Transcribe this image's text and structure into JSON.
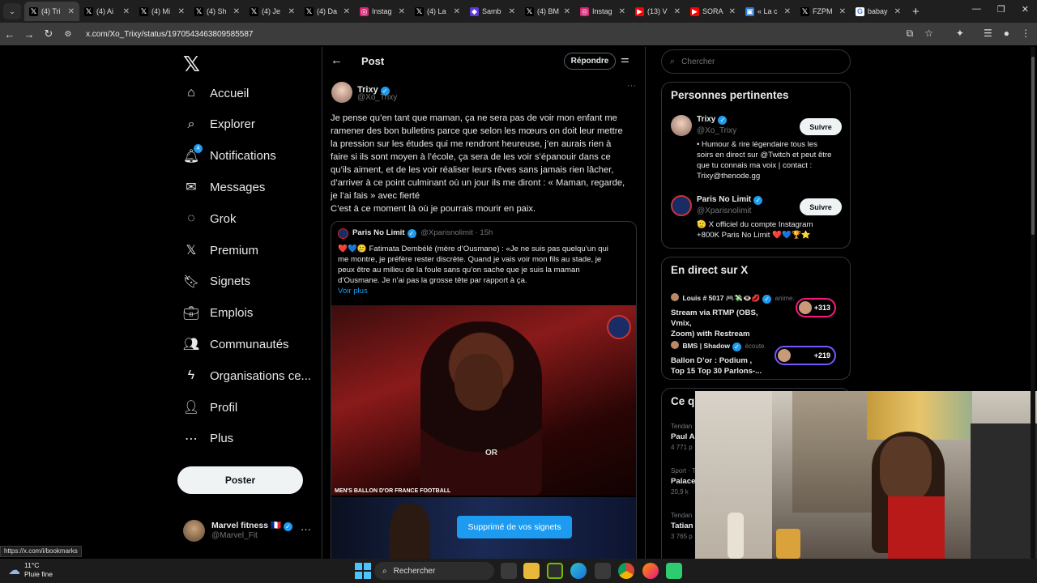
{
  "browser": {
    "tabs": [
      {
        "icon": "x-icon",
        "label": "(4) Tri",
        "active": true
      },
      {
        "icon": "x-icon",
        "label": "(4) Ai"
      },
      {
        "icon": "x-icon",
        "label": "(4) Mi"
      },
      {
        "icon": "x-icon",
        "label": "(4) Sh"
      },
      {
        "icon": "x-icon",
        "label": "(4) Je"
      },
      {
        "icon": "x-icon",
        "label": "(4) Da"
      },
      {
        "icon": "instagram-icon",
        "label": "Instag"
      },
      {
        "icon": "x-icon",
        "label": "(4) La"
      },
      {
        "icon": "samba-icon",
        "label": "Samb"
      },
      {
        "icon": "x-icon",
        "label": "(4) BM"
      },
      {
        "icon": "instagram-icon",
        "label": "Instag"
      },
      {
        "icon": "youtube-icon",
        "label": "(13) V"
      },
      {
        "icon": "youtube-icon",
        "label": "SORA"
      },
      {
        "icon": "generic-icon",
        "label": "« La c"
      },
      {
        "icon": "x-icon",
        "label": "FZPM"
      },
      {
        "icon": "google-icon",
        "label": "babay"
      }
    ],
    "url": "x.com/Xo_Trixy/status/1970543463809585587",
    "status_url": "https://x.com/i/bookmarks"
  },
  "nav": {
    "items": [
      {
        "label": "Accueil",
        "icon": "home-icon"
      },
      {
        "label": "Explorer",
        "icon": "search-icon"
      },
      {
        "label": "Notifications",
        "icon": "bell-icon",
        "badge": "4"
      },
      {
        "label": "Messages",
        "icon": "envelope-icon"
      },
      {
        "label": "Grok",
        "icon": "grok-icon"
      },
      {
        "label": "Premium",
        "icon": "x-icon"
      },
      {
        "label": "Signets",
        "icon": "bookmark-icon"
      },
      {
        "label": "Emplois",
        "icon": "briefcase-icon"
      },
      {
        "label": "Communautés",
        "icon": "people-icon"
      },
      {
        "label": "Organisations ce...",
        "icon": "lightning-icon"
      },
      {
        "label": "Profil",
        "icon": "person-icon"
      },
      {
        "label": "Plus",
        "icon": "more-circle-icon"
      }
    ],
    "post_button": "Poster",
    "account": {
      "name": "Marvel fitness 🇫🇷",
      "handle": "@Marvel_Fit"
    }
  },
  "main": {
    "header_title": "Post",
    "reply_button": "Répondre",
    "tweet": {
      "author": "Trixy",
      "handle": "@Xo_Trixy",
      "text_lines": [
        "Je pense qu’en tant que maman, ça ne sera pas de voir mon enfant me",
        "ramener des bon bulletins parce que selon les mœurs on doit leur mettre",
        "la pression sur les études qui me rendront heureuse, j’en aurais rien à",
        "faire si ils sont moyen à l’école, ça sera de les voir s’épanouir dans ce",
        "qu’ils aiment, et de les voir réaliser leurs rêves sans jamais rien lâcher,",
        "d’arriver à ce point culminant où un jour ils me diront : « Maman, regarde,",
        "je l’ai fais » avec fierté",
        "C’est à ce moment là où je pourrais mourir en paix."
      ]
    },
    "quote": {
      "author": "Paris No Limit",
      "handle": "@Xparisnolimit",
      "time": "· 15h",
      "text_lines": [
        "❤️💙🥲 Fatimata Dembélé (mère d’Ousmane) : «Je ne suis pas quelqu’un qui",
        "me montre, je préfère rester discrète. Quand je vais voir mon fils au stade, je",
        "peux être au milieu de la foule sans qu’on sache que je suis la maman",
        "d’Ousmane. Je n’ai pas la grosse tête par rapport à ça."
      ],
      "see_more": "Voir plus",
      "image_caption": "MEN'S BALLON D'OR FRANCE FOOTBALL",
      "image_text": "OR"
    },
    "toast": "Supprimé de vos signets"
  },
  "right": {
    "search_placeholder": "Chercher",
    "relevant": {
      "title": "Personnes pertinentes",
      "people": [
        {
          "name": "Trixy",
          "handle": "@Xo_Trixy",
          "follow": "Suivre",
          "bio_lines": [
            "• Humour & rire légendaire tous les",
            "soirs en direct sur @Twitch et peut être",
            "que tu connais ma voix | contact :",
            "Trixy@thenode.gg"
          ]
        },
        {
          "name": "Paris No Limit",
          "handle": "@Xparisnolimit",
          "follow": "Suivre",
          "bio_lines": [
            "🫡 X officiel du compte Instagram",
            "+800K Paris No Limit ❤️💙🏆⭐"
          ]
        }
      ]
    },
    "live": {
      "title": "En direct sur X",
      "items": [
        {
          "user": "Louis # 5017 🎮💸👁️💋",
          "action": "anime.",
          "title_lines": [
            "Stream via RTMP (OBS, Vmix,",
            "Zoom) with Restream"
          ],
          "count": "+313"
        },
        {
          "user": "BMS | Shadow",
          "action": "écoute.",
          "title_lines": [
            "Ballon D’or : Podium ,",
            "Top 15 Top 30 Parlons-..."
          ],
          "count": "+219"
        }
      ]
    },
    "trends": {
      "title": "Ce q",
      "items": [
        {
          "context": "Tendan",
          "name": "Paul A",
          "count": "4 771 p"
        },
        {
          "context": "Sport · T",
          "name": "Palace",
          "count": "20,9 k"
        },
        {
          "context": "Tendan",
          "name": "Tatian",
          "count": "3 765 p"
        }
      ]
    }
  },
  "taskbar": {
    "weather_temp": "11°C",
    "weather_desc": "Pluie fine",
    "search_label": "Rechercher"
  }
}
